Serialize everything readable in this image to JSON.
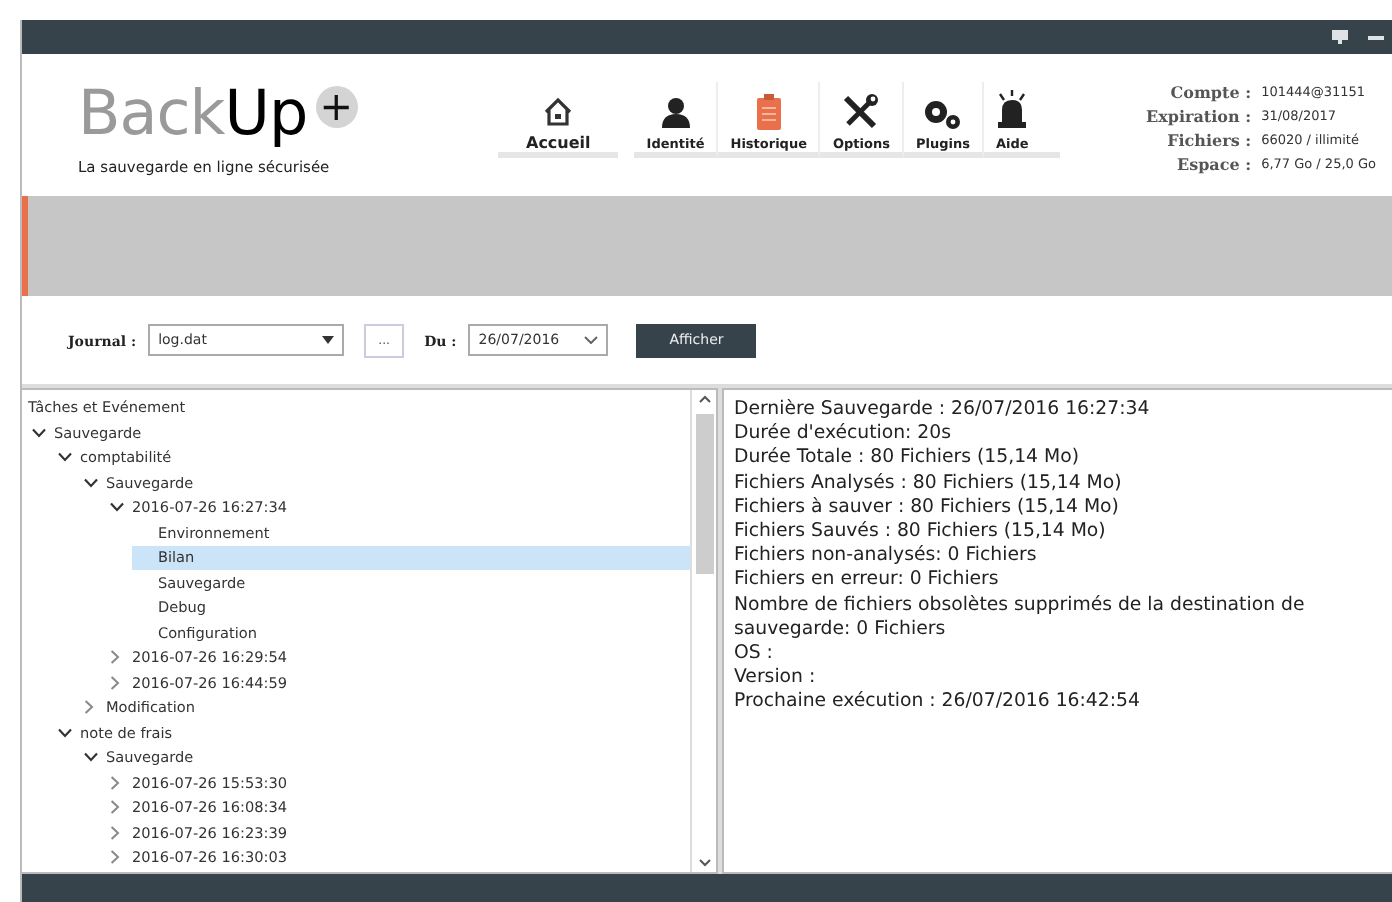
{
  "logo": {
    "light": "Back",
    "bold": "Up",
    "badge": "+",
    "tagline": "La sauvegarde en ligne sécurisée"
  },
  "nav": [
    {
      "label": "Accueil",
      "kind": "home",
      "selected": true
    },
    {
      "label": "Identité",
      "kind": "person",
      "selected": false
    },
    {
      "label": "Historique",
      "kind": "clipboard",
      "selected": false
    },
    {
      "label": "Options",
      "kind": "tools",
      "selected": false
    },
    {
      "label": "Plugins",
      "kind": "gears",
      "selected": false
    },
    {
      "label": "Aide",
      "kind": "beacon",
      "selected": false
    }
  ],
  "account": [
    {
      "label": "Compte :",
      "value": "101444@31151"
    },
    {
      "label": "Expiration :",
      "value": "31/08/2017"
    },
    {
      "label": "Fichiers :",
      "value": "66020 / illimité"
    },
    {
      "label": "Espace :",
      "value": "6,77 Go / 25,0 Go"
    }
  ],
  "toolbar": {
    "journal_label": "Journal :",
    "journal_value": "log.dat",
    "browse": "...",
    "date_label": "Du :",
    "date_value": "26/07/2016",
    "button": "Afficher"
  },
  "tree": {
    "header": "Tâches et Evénement",
    "items": [
      {
        "label": "Sauvegarde",
        "expanded": true,
        "selected": false,
        "children": [
          {
            "label": "comptabilité",
            "expanded": true,
            "selected": false,
            "children": [
              {
                "label": "Sauvegarde",
                "expanded": true,
                "selected": false,
                "children": [
                  {
                    "label": "2016-07-26  16:27:34",
                    "expanded": true,
                    "selected": false,
                    "children": [
                      {
                        "label": "Environnement",
                        "selected": false
                      },
                      {
                        "label": "Bilan",
                        "selected": true
                      },
                      {
                        "label": "Sauvegarde",
                        "selected": false
                      },
                      {
                        "label": "Debug",
                        "selected": false
                      },
                      {
                        "label": "Configuration",
                        "selected": false
                      }
                    ]
                  },
                  {
                    "label": "2016-07-26  16:29:54",
                    "expanded": false,
                    "selected": false
                  },
                  {
                    "label": "2016-07-26  16:44:59",
                    "expanded": false,
                    "selected": false
                  }
                ]
              },
              {
                "label": "Modification",
                "expanded": false,
                "selected": false
              }
            ]
          },
          {
            "label": "note de frais",
            "expanded": true,
            "selected": false,
            "children": [
              {
                "label": "Sauvegarde",
                "expanded": true,
                "selected": false,
                "children": [
                  {
                    "label": "2016-07-26  15:53:30",
                    "expanded": false,
                    "selected": false
                  },
                  {
                    "label": "2016-07-26  16:08:34",
                    "expanded": false,
                    "selected": false
                  },
                  {
                    "label": "2016-07-26  16:23:39",
                    "expanded": false,
                    "selected": false
                  },
                  {
                    "label": "2016-07-26  16:30:03",
                    "expanded": false,
                    "selected": false
                  }
                ]
              }
            ]
          }
        ]
      }
    ]
  },
  "report": [
    "Dernière Sauvegarde : 26/07/2016 16:27:34",
    "Durée d'exécution: 20s",
    "Durée Totale : 80 Fichiers (15,14 Mo)",
    "Fichiers Analysés : 80 Fichiers (15,14 Mo)",
    "Fichiers à sauver : 80 Fichiers (15,14 Mo)",
    "Fichiers Sauvés : 80 Fichiers (15,14 Mo)",
    "Fichiers non-analysés:  0 Fichiers",
    "Fichiers en erreur:  0 Fichiers",
    "Nombre de fichiers obsolètes supprimés de la destination de sauvegarde:  0 Fichiers",
    "OS :",
    "Version :",
    "Prochaine exécution : 26/07/2016 16:42:54"
  ]
}
